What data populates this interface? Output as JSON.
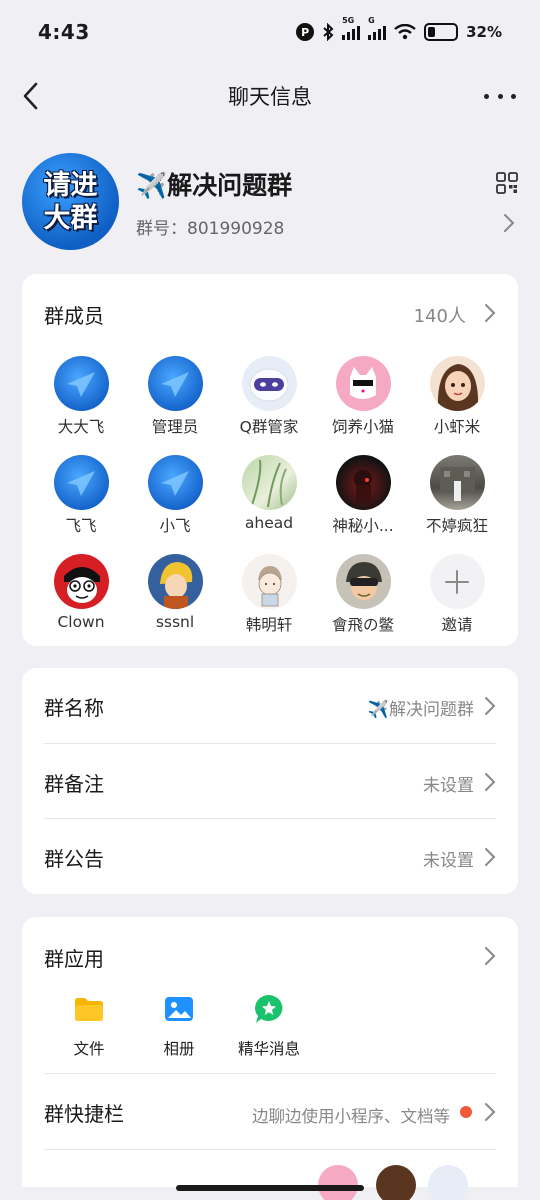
{
  "status_bar": {
    "time": "4:43",
    "network_1": "5G",
    "network_2": "G",
    "battery": "32%"
  },
  "nav": {
    "title": "聊天信息"
  },
  "group": {
    "avatar_line1": "请进",
    "avatar_line2": "大群",
    "name": "✈️解决问题群",
    "id_label": "群号：801990928"
  },
  "members_section": {
    "title": "群成员",
    "count": "140人",
    "members": [
      {
        "name": "大大飞"
      },
      {
        "name": "管理员"
      },
      {
        "name": "Q群管家"
      },
      {
        "name": "饲养小猫"
      },
      {
        "name": "小虾米"
      },
      {
        "name": "飞飞"
      },
      {
        "name": "小飞"
      },
      {
        "name": "ahead"
      },
      {
        "name": "神秘小..."
      },
      {
        "name": "不婷疯狂"
      },
      {
        "name": "Clown"
      },
      {
        "name": "sssnl"
      },
      {
        "name": "韩明轩"
      },
      {
        "name": "會飛の鳖"
      },
      {
        "name": "邀请"
      }
    ]
  },
  "info": {
    "group_name_label": "群名称",
    "group_name_value": "✈️解决问题群",
    "remark_label": "群备注",
    "remark_value": "未设置",
    "notice_label": "群公告",
    "notice_value": "未设置"
  },
  "apps": {
    "title": "群应用",
    "items": [
      {
        "label": "文件"
      },
      {
        "label": "相册"
      },
      {
        "label": "精华消息"
      }
    ],
    "quick_bar_label": "群快捷栏",
    "quick_bar_value": "边聊边使用小程序、文档等"
  },
  "colors": {
    "background": "#efeff4",
    "card": "#ffffff",
    "accent_blue": "#1a73e8",
    "file_yellow": "#f7b500",
    "album_blue": "#1e90ff",
    "essence_green": "#19c26b",
    "dot_red": "#f05a3b"
  }
}
